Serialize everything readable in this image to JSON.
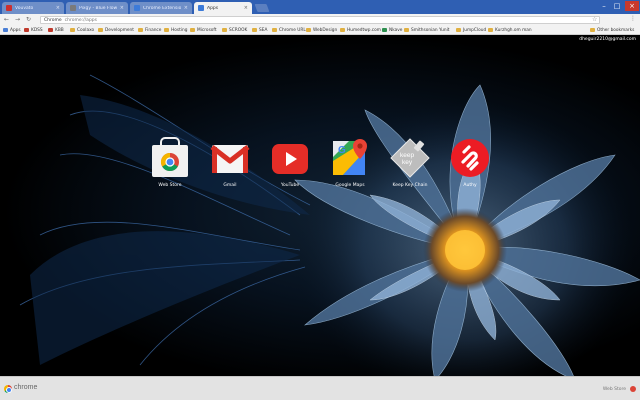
{
  "tabs": [
    {
      "title": "Vouvato",
      "favicon_color": "#cc2f2f",
      "active": false
    },
    {
      "title": "Pixgy - Blue Flower - Bac",
      "favicon_color": "#7a7a7a",
      "active": false
    },
    {
      "title": "Chrome Extensions Downloader",
      "favicon_color": "#3d7bd9",
      "active": false
    },
    {
      "title": "Apps",
      "favicon_color": "#3d7bd9",
      "active": true
    }
  ],
  "toolbar": {
    "back_icon": "back-arrow-icon",
    "forward_icon": "forward-arrow-icon",
    "reload_icon": "reload-icon",
    "omnibox": {
      "scheme": "Chrome",
      "path": "chrome://apps"
    },
    "star_icon": "star-icon",
    "menu_icon": "menu-dots-icon"
  },
  "bookmarks": [
    {
      "label": "Apps",
      "color": "#4a7fd6"
    },
    {
      "label": "KDSS",
      "color": "#c0392b"
    },
    {
      "label": "KBB",
      "color": "#c0392b"
    },
    {
      "label": "Coolaxo",
      "color": "#e0b040"
    },
    {
      "label": "Development",
      "color": "#e0b040"
    },
    {
      "label": "Finance",
      "color": "#e0b040"
    },
    {
      "label": "Hosting",
      "color": "#e0b040"
    },
    {
      "label": "Microsoft",
      "color": "#e0b040"
    },
    {
      "label": "SCROOK",
      "color": "#e0b040"
    },
    {
      "label": "SEA",
      "color": "#e0b040"
    },
    {
      "label": "Chrome URLs",
      "color": "#e0b040"
    },
    {
      "label": "WebDesign",
      "color": "#e0b040"
    },
    {
      "label": "Humedtwp.com",
      "color": "#e0b040"
    },
    {
      "label": "Nkave",
      "color": "#2d8f4e"
    },
    {
      "label": "Smithsonian Yunit",
      "color": "#e0b040"
    },
    {
      "label": "JumpCloud",
      "color": "#e0b040"
    },
    {
      "label": "Kurzhgh.om man",
      "color": "#e0b040"
    },
    {
      "label": "Other bookmarks",
      "color": "#e0b040"
    }
  ],
  "account_email": "dheguir2210@gmail.com",
  "apps": [
    {
      "name": "Web Store",
      "icon": "web-store-icon"
    },
    {
      "name": "Gmail",
      "icon": "gmail-icon"
    },
    {
      "name": "YouTube",
      "icon": "youtube-icon"
    },
    {
      "name": "Google Maps",
      "icon": "google-maps-icon"
    },
    {
      "name": "Keep Key Chain",
      "icon": "keepkey-icon"
    },
    {
      "name": "Authy",
      "icon": "authy-icon"
    }
  ],
  "shelf": {
    "brand": "chrome",
    "right_text": "Web Store"
  },
  "colors": {
    "tabstrip": "#2f5fb3",
    "gmail_red": "#d93025",
    "youtube_red": "#e52d27",
    "authy_red": "#ec1c24"
  }
}
